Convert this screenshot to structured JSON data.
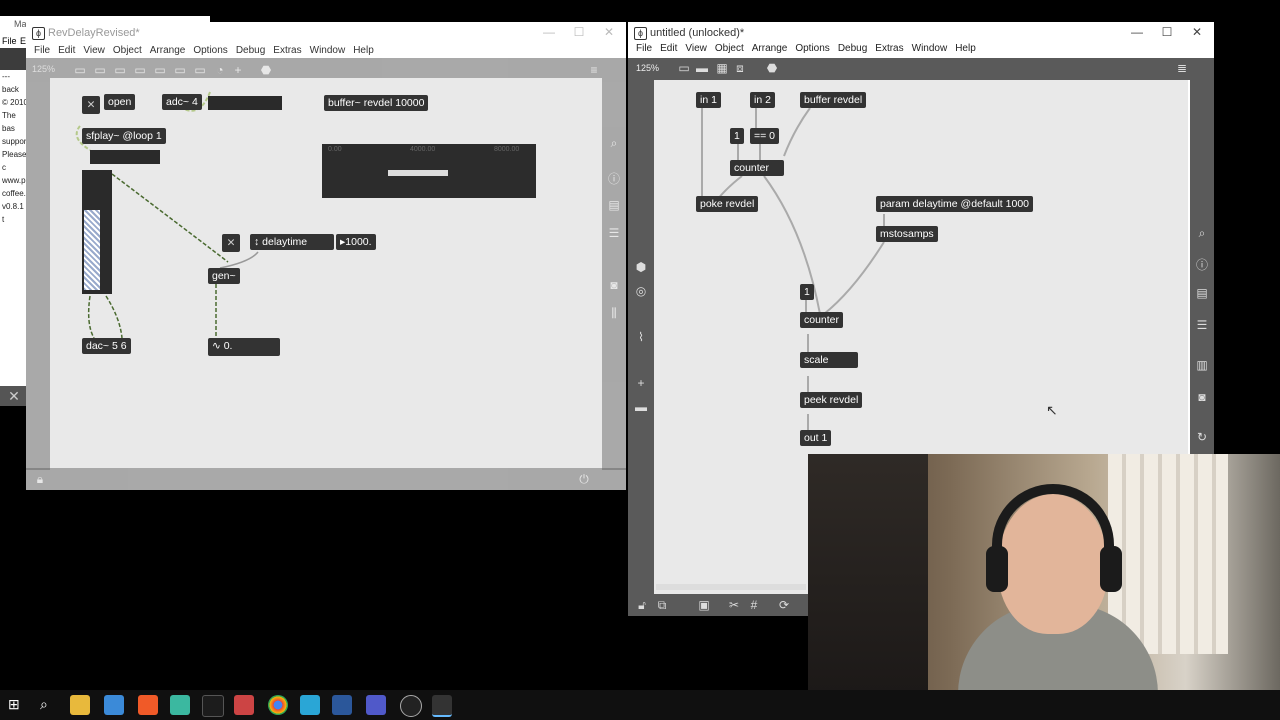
{
  "back_window": {
    "menu": [
      "File",
      "E"
    ],
    "title": "Ma",
    "lines": [
      "--- back",
      "© 2010",
      "The bas",
      "support",
      "Please c",
      "www.p",
      "coffee.",
      "v0.8.1 t"
    ]
  },
  "left_window": {
    "title": "RevDelayRevised*",
    "menu": [
      "File",
      "Edit",
      "View",
      "Object",
      "Arrange",
      "Options",
      "Debug",
      "Extras",
      "Window",
      "Help"
    ],
    "zoom": "125%",
    "objects": {
      "open_msg": "open",
      "adc": "adc~ 4",
      "buffer": "buffer~ revdel 10000",
      "sfplay": "sfplay~ @loop 1",
      "delay_label": "delaytime",
      "delay_value": "1000.",
      "gen": "gen~",
      "dac": "dac~ 5 6",
      "number_out": "0.",
      "wave_ticks": [
        "0.00",
        "4000.00",
        "8000.00"
      ]
    }
  },
  "right_window": {
    "title": "untitled (unlocked)*",
    "menu": [
      "File",
      "Edit",
      "View",
      "Object",
      "Arrange",
      "Options",
      "Debug",
      "Extras",
      "Window",
      "Help"
    ],
    "zoom": "125%",
    "objects": {
      "in1": "in 1",
      "in2": "in 2",
      "buffer": "buffer revdel",
      "one_a": "1",
      "eq0": "== 0",
      "counter_a": "counter",
      "poke": "poke revdel",
      "param": "param delaytime @default 1000",
      "mstosamps": "mstosamps",
      "one_b": "1",
      "counter_b": "counter",
      "scale": "scale",
      "peek": "peek revdel",
      "out1": "out 1"
    }
  },
  "webcam": {
    "description_tag": "webcam-person"
  },
  "taskbar": {
    "apps": [
      "windows-start-icon",
      "search-icon",
      "file-explorer-icon",
      "mail-icon",
      "brave-icon",
      "app-icon",
      "vpn-icon",
      "app-icon",
      "chrome-icon",
      "app-icon",
      "word-icon",
      "teams-icon",
      "app-icon",
      "max-icon"
    ]
  },
  "colors": {
    "patch_bg": "#e9e9e9",
    "object_bg": "#333333",
    "toolbar": "#5a5a5a",
    "cable_green": "#b5c98a"
  }
}
